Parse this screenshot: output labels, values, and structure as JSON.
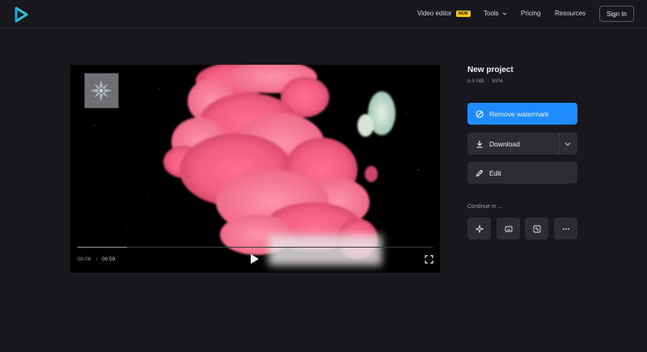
{
  "header": {
    "logo": "play-logo-icon",
    "nav": [
      {
        "label": "Video editor",
        "badge": "NEW"
      },
      {
        "label": "Tools",
        "has_dropdown": true
      },
      {
        "label": "Pricing"
      },
      {
        "label": "Resources"
      }
    ],
    "signin_label": "Sign In"
  },
  "player": {
    "current_time": "00:06",
    "separator": "/",
    "duration": "00:59",
    "progress": 0.14
  },
  "project": {
    "title": "New project",
    "size": "6.5 MB",
    "meta_sep": "/",
    "format": "MP4"
  },
  "actions": {
    "remove_watermark": "Remove watermark",
    "download": "Download",
    "edit": "Edit"
  },
  "continue": {
    "label": "Continue in ...",
    "tools": [
      "sparkle-icon",
      "subtitles-icon",
      "resize-icon",
      "more-icon"
    ]
  },
  "colors": {
    "background": "#18181c",
    "accent": "#1e8cff",
    "badge": "#f5c518",
    "button": "#2c2c32"
  }
}
